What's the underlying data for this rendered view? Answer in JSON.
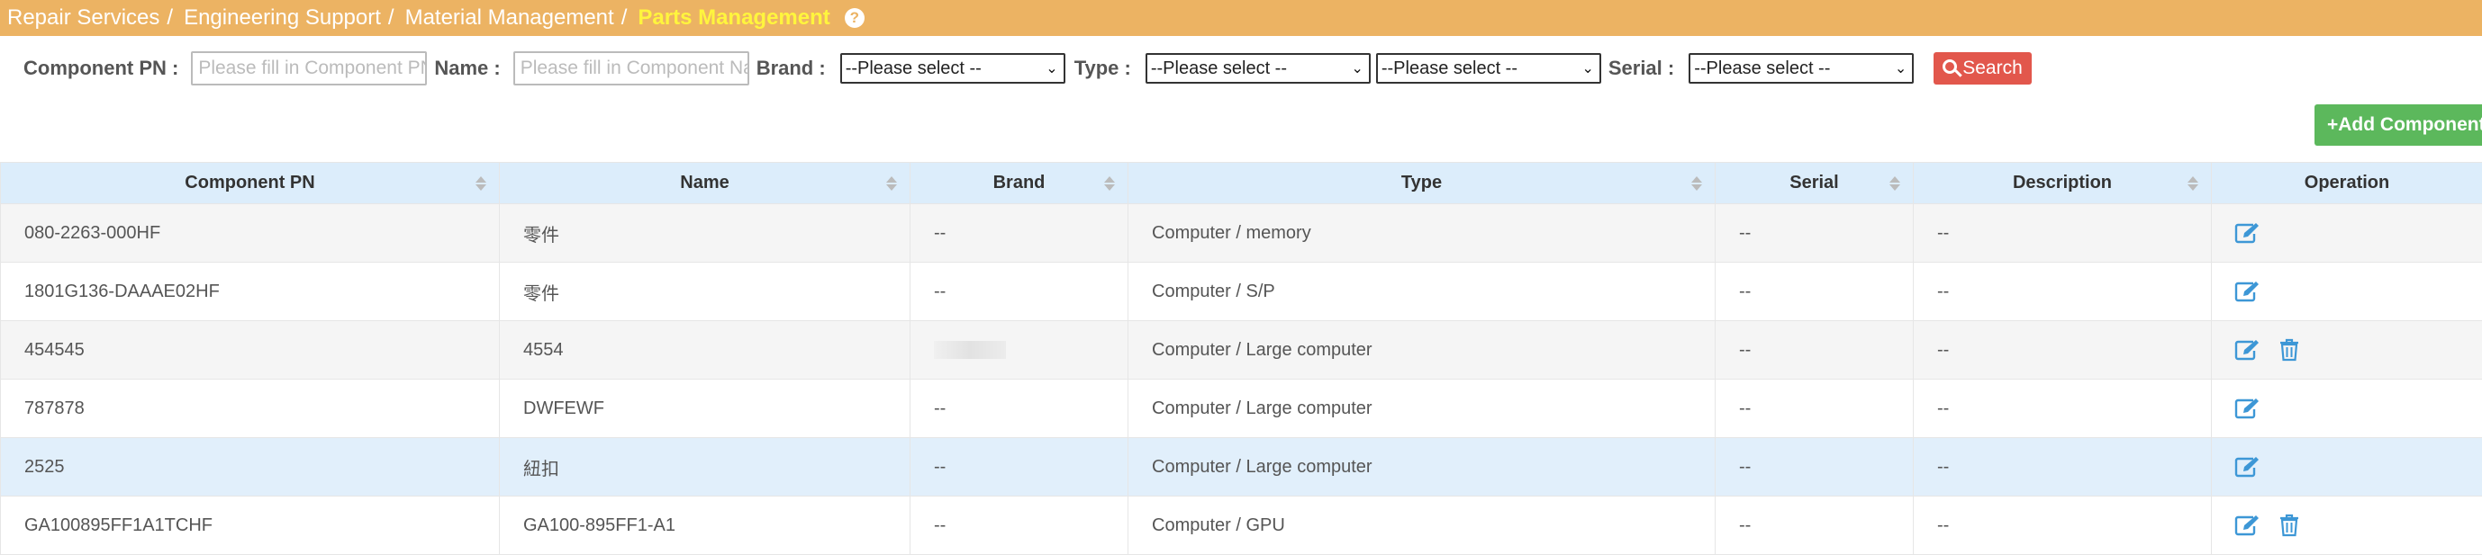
{
  "breadcrumb": {
    "items": [
      "Repair Services",
      "Engineering Support",
      "Material Management"
    ],
    "separator": "/",
    "active": "Parts Management"
  },
  "filters": {
    "component_pn_label": "Component PN :",
    "component_pn_placeholder": "Please fill in  Component PN",
    "name_label": "Name :",
    "name_placeholder": "Please fill in  Component Name",
    "brand_label": "Brand :",
    "brand_value": "--Please select --",
    "type_label": "Type :",
    "type_value_1": "--Please select --",
    "type_value_2": "--Please select --",
    "serial_label": "Serial :",
    "serial_value": "--Please select --",
    "search_label": "Search"
  },
  "add_button": "+Add Component",
  "table": {
    "headers": [
      "Component PN",
      "Name",
      "Brand",
      "Type",
      "Serial",
      "Description",
      "Operation"
    ],
    "rows": [
      {
        "pn": "080-2263-000HF",
        "name": "零件",
        "brand": "--",
        "type": "Computer / memory",
        "serial": "--",
        "description": "--",
        "deletable": false
      },
      {
        "pn": "1801G136-DAAAE02HF",
        "name": "零件",
        "brand": "--",
        "type": "Computer / S/P",
        "serial": "--",
        "description": "--",
        "deletable": false
      },
      {
        "pn": "454545",
        "name": "4554",
        "brand": "",
        "type": "Computer / Large computer",
        "serial": "--",
        "description": "--",
        "deletable": true
      },
      {
        "pn": "787878",
        "name": "DWFEWF",
        "brand": "--",
        "type": "Computer / Large computer",
        "serial": "--",
        "description": "--",
        "deletable": false
      },
      {
        "pn": "2525",
        "name": "紐扣",
        "brand": "--",
        "type": "Computer / Large computer",
        "serial": "--",
        "description": "--",
        "deletable": false
      },
      {
        "pn": "GA100895FF1A1TCHF",
        "name": "GA100-895FF1-A1",
        "brand": "--",
        "type": "Computer / GPU",
        "serial": "--",
        "description": "--",
        "deletable": true
      }
    ]
  },
  "colors": {
    "topbar": "#ecb363",
    "active_crumb": "#fff53d",
    "search_button": "#e2574c",
    "add_button": "#5cb85c",
    "header_row": "#dcedfb",
    "highlight_row": "#e1effb",
    "icon_blue": "#3d97d6"
  }
}
